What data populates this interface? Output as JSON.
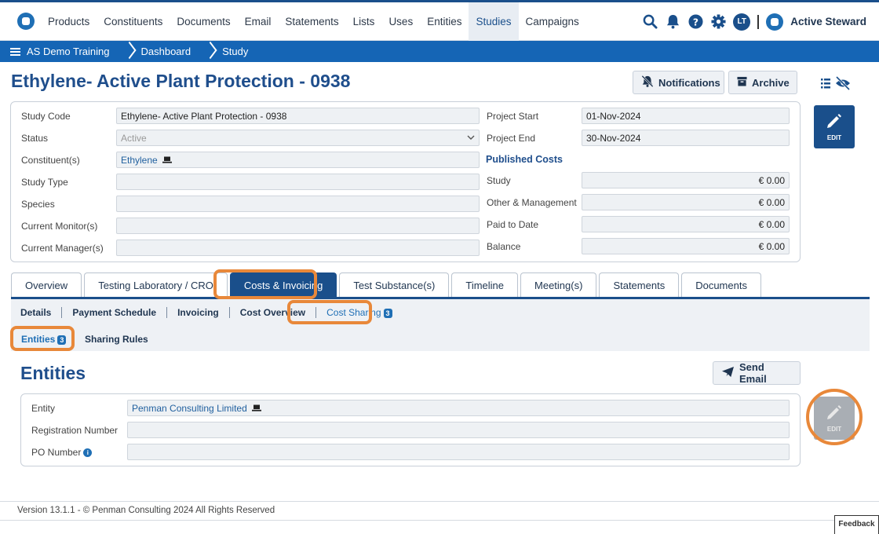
{
  "nav": {
    "items": [
      "Products",
      "Constituents",
      "Documents",
      "Email",
      "Statements",
      "Lists",
      "Uses",
      "Entities",
      "Studies",
      "Campaigns"
    ],
    "active": "Studies",
    "avatar_initials": "LT",
    "brand": "Active Steward"
  },
  "breadcrumb": [
    "AS Demo Training",
    "Dashboard",
    "Study"
  ],
  "page": {
    "title": "Ethylene- Active Plant Protection - 0938",
    "notifications_label": "Notifications",
    "archive_label": "Archive",
    "edit_label": "EDIT"
  },
  "study": {
    "code_label": "Study Code",
    "code": "Ethylene- Active Plant Protection - 0938",
    "status_label": "Status",
    "status": "Active",
    "constituents_label": "Constituent(s)",
    "constituents": "Ethylene",
    "type_label": "Study Type",
    "type": "",
    "species_label": "Species",
    "species": "",
    "monitor_label": "Current Monitor(s)",
    "monitor": "",
    "manager_label": "Current Manager(s)",
    "manager": "",
    "project_start_label": "Project Start",
    "project_start": "01-Nov-2024",
    "project_end_label": "Project End",
    "project_end": "30-Nov-2024",
    "published_costs_label": "Published Costs",
    "costs": [
      {
        "label": "Study",
        "value": "€ 0.00"
      },
      {
        "label": "Other & Management",
        "value": "€ 0.00"
      },
      {
        "label": "Paid to Date",
        "value": "€ 0.00"
      },
      {
        "label": "Balance",
        "value": "€ 0.00"
      }
    ]
  },
  "tabs": [
    "Overview",
    "Testing Laboratory / CRO",
    "Costs & Invoicing",
    "Test Substance(s)",
    "Timeline",
    "Meeting(s)",
    "Statements",
    "Documents"
  ],
  "subtabs": {
    "items": [
      "Details",
      "Payment Schedule",
      "Invoicing",
      "Cost Overview",
      "Cost Sharing"
    ],
    "cost_sharing_count": "3",
    "level2": [
      "Entities",
      "Sharing Rules"
    ],
    "entities_count": "3"
  },
  "entities": {
    "heading": "Entities",
    "send_email_label": "Send Email",
    "entity_label": "Entity",
    "entity": "Penman Consulting Limited",
    "reg_label": "Registration Number",
    "reg": "",
    "po_label": "PO Number",
    "po": "",
    "edit_label": "EDIT"
  },
  "footer": {
    "text": "Version 13.1.1 - © Penman Consulting 2024 All Rights Reserved",
    "feedback": "Feedback"
  },
  "colors": {
    "brand": "#1a4f8b",
    "crumbbar": "#1565b5",
    "highlight": "#e8883a"
  }
}
